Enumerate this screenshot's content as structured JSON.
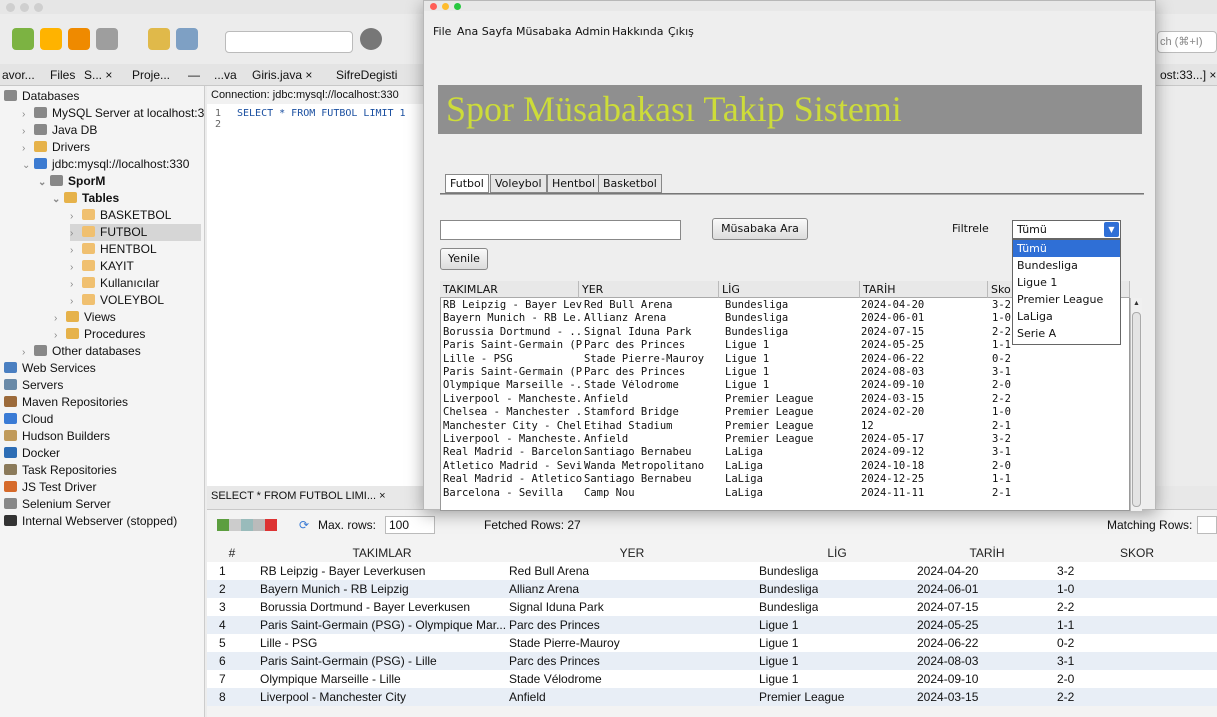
{
  "ide": {
    "search_placeholder": "ch (⌘+I)",
    "editor_tabs": [
      "avor...",
      "Files",
      "S... ×",
      "Proje...",
      "—",
      "...va",
      "Giris.java ×",
      "SifreDegisti",
      "ost:33...] ×"
    ],
    "connection_label": "Connection:",
    "connection_value": "jdbc:mysql://localhost:330",
    "sql_lines": [
      "1",
      "2"
    ],
    "sql_text": "SELECT * FROM FUTBOL LIMIT 1",
    "tree": [
      "Databases",
      "MySQL Server at localhost:3",
      "Java DB",
      "Drivers",
      "jdbc:mysql://localhost:330",
      "SporM",
      "Tables",
      "BASKETBOL",
      "FUTBOL",
      "HENTBOL",
      "KAYIT",
      "Kullanıcılar",
      "VOLEYBOL",
      "Views",
      "Procedures",
      "Other databases",
      "Web Services",
      "Servers",
      "Maven Repositories",
      "Cloud",
      "Hudson Builders",
      "Docker",
      "Task Repositories",
      "JS Test Driver",
      "Selenium Server",
      "Internal Webserver (stopped)"
    ],
    "result_tab": "SELECT * FROM FUTBOL LIMI... ×",
    "max_rows_label": "Max. rows:",
    "max_rows_value": "100",
    "fetched_rows": "Fetched Rows: 27",
    "matching_rows": "Matching Rows:",
    "grid_headers": [
      "#",
      "TAKIMLAR",
      "YER",
      "LİG",
      "TARİH",
      "SKOR"
    ],
    "grid_rows": [
      [
        "1",
        "RB Leipzig - Bayer Leverkusen",
        "Red Bull Arena",
        "Bundesliga",
        "2024-04-20",
        "3-2"
      ],
      [
        "2",
        "Bayern Munich - RB Leipzig",
        "Allianz Arena",
        "Bundesliga",
        "2024-06-01",
        "1-0"
      ],
      [
        "3",
        "Borussia Dortmund - Bayer Leverkusen",
        "Signal Iduna Park",
        "Bundesliga",
        "2024-07-15",
        "2-2"
      ],
      [
        "4",
        "Paris Saint-Germain (PSG) - Olympique Mar...",
        "Parc des Princes",
        "Ligue 1",
        "2024-05-25",
        "1-1"
      ],
      [
        "5",
        "Lille - PSG",
        "Stade Pierre-Mauroy",
        "Ligue 1",
        "2024-06-22",
        "0-2"
      ],
      [
        "6",
        "Paris Saint-Germain (PSG) - Lille",
        "Parc des Princes",
        "Ligue 1",
        "2024-08-03",
        "3-1"
      ],
      [
        "7",
        "Olympique Marseille - Lille",
        "Stade Vélodrome",
        "Ligue 1",
        "2024-09-10",
        "2-0"
      ],
      [
        "8",
        "Liverpool - Manchester City",
        "Anfield",
        "Premier League",
        "2024-03-15",
        "2-2"
      ]
    ]
  },
  "app": {
    "menu": [
      "File",
      "Ana Sayfa",
      "Müsabaka Admin",
      "Hakkında",
      "Çıkış"
    ],
    "title": "Spor Müsabakası Takip Sistemi",
    "tabs": [
      "Futbol",
      "Voleybol",
      "Hentbol",
      "Basketbol"
    ],
    "search_value": "",
    "search_button": "Müsabaka Ara",
    "refresh_button": "Yenile",
    "filter_label": "Filtrele",
    "filter_selected": "Tümü",
    "filter_options": [
      "Tümü",
      "Bundesliga",
      "Ligue 1",
      "Premier League",
      "LaLiga",
      "Serie A"
    ],
    "table_headers": [
      "TAKIMLAR",
      "YER",
      "LİG",
      "TARİH",
      "Sko"
    ],
    "table_rows": [
      [
        "RB Leipzig - Bayer Lev...",
        "Red Bull Arena",
        "Bundesliga",
        "2024-04-20",
        "3-2"
      ],
      [
        "Bayern Munich - RB Le...",
        "Allianz Arena",
        "Bundesliga",
        "2024-06-01",
        "1-0"
      ],
      [
        "Borussia Dortmund - ...",
        "Signal Iduna Park",
        "Bundesliga",
        "2024-07-15",
        "2-2"
      ],
      [
        "Paris Saint-Germain (P...",
        "Parc des Princes",
        "Ligue 1",
        "2024-05-25",
        "1-1"
      ],
      [
        "Lille - PSG",
        "Stade Pierre-Mauroy",
        "Ligue 1",
        "2024-06-22",
        "0-2"
      ],
      [
        "Paris Saint-Germain (P...",
        "Parc des Princes",
        "Ligue 1",
        "2024-08-03",
        "3-1"
      ],
      [
        "Olympique Marseille -...",
        "Stade Vélodrome",
        "Ligue 1",
        "2024-09-10",
        "2-0"
      ],
      [
        "Liverpool - Mancheste...",
        "Anfield",
        "Premier League",
        "2024-03-15",
        "2-2"
      ],
      [
        "Chelsea - Manchester ...",
        "Stamford Bridge",
        "Premier League",
        "2024-02-20",
        "1-0"
      ],
      [
        "Manchester City - Chel...",
        "Etihad Stadium",
        "Premier League",
        "12",
        "2-1"
      ],
      [
        "Liverpool - Mancheste...",
        "Anfield",
        "Premier League",
        "2024-05-17",
        "3-2"
      ],
      [
        "Real Madrid - Barcelona",
        "Santiago Bernabeu",
        "LaLiga",
        "2024-09-12",
        "3-1"
      ],
      [
        "Atletico Madrid - Sevilla",
        "Wanda Metropolitano",
        "LaLiga",
        "2024-10-18",
        "2-0"
      ],
      [
        "Real Madrid - Atletico ...",
        "Santiago Bernabeu",
        "LaLiga",
        "2024-12-25",
        "1-1"
      ],
      [
        "Barcelona - Sevilla",
        "Camp Nou",
        "LaLiga",
        "2024-11-11",
        "2-1"
      ]
    ]
  },
  "colors": {
    "banner_bg": "#8f8f8f",
    "banner_text": "#cddc39",
    "select_blue": "#2f6fd6"
  }
}
